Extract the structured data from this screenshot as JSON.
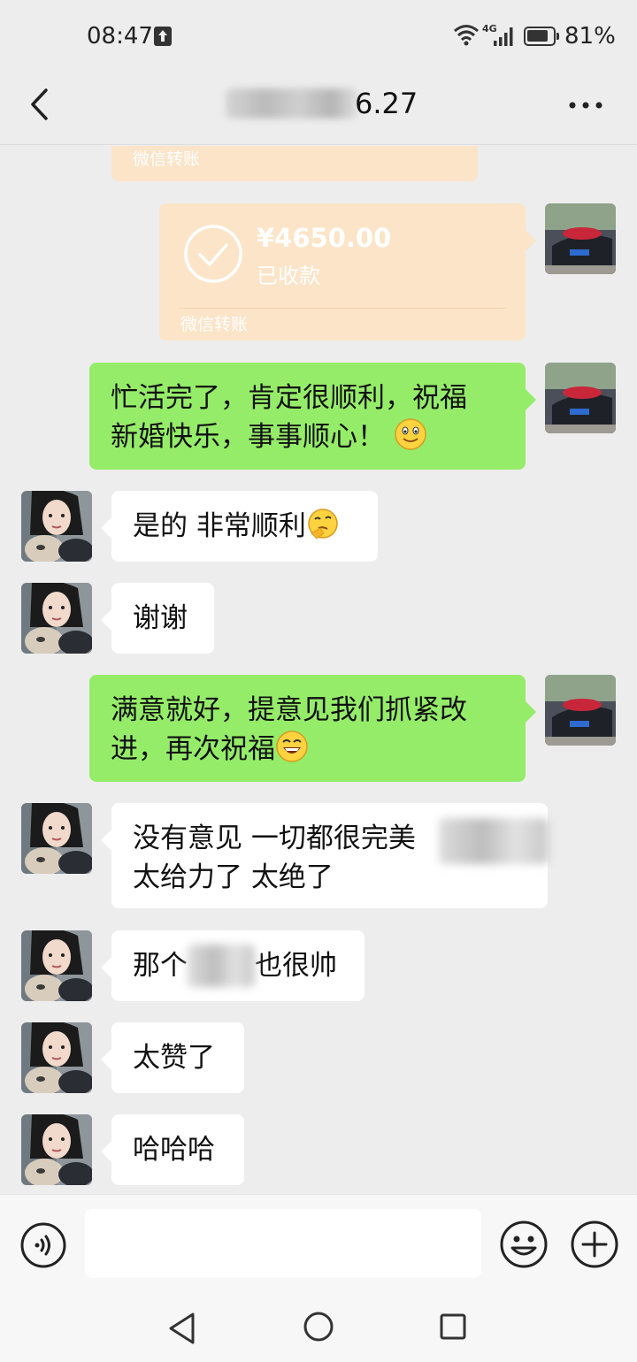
{
  "status_bar": {
    "time": "08:47",
    "network": "4G",
    "battery_percent": "81%"
  },
  "header": {
    "title_visible_suffix": "6.27"
  },
  "messages": [
    {
      "id": "transfer-0",
      "side": "left",
      "type": "transfer",
      "label": "微信转账"
    },
    {
      "id": "transfer-1",
      "side": "right",
      "type": "transfer",
      "amount": "¥4650.00",
      "status": "已收款",
      "label": "微信转账"
    },
    {
      "id": "m2",
      "side": "right",
      "type": "text",
      "lines": [
        "忙活完了，肯定很顺利，祝福",
        "新婚快乐，事事顺心！"
      ],
      "emoji": "smile"
    },
    {
      "id": "m3",
      "side": "left",
      "type": "text",
      "lines": [
        "是的 非常顺利"
      ],
      "emoji": "thinking"
    },
    {
      "id": "m4",
      "side": "left",
      "type": "text",
      "lines": [
        "谢谢"
      ]
    },
    {
      "id": "m5",
      "side": "right",
      "type": "text",
      "lines": [
        "满意就好，提意见我们抓紧改",
        "进，再次祝福"
      ],
      "emoji": "grin"
    },
    {
      "id": "m6",
      "side": "left",
      "type": "text",
      "lines": [
        "没有意见 一切都很完美 ",
        "太给力了 太绝了"
      ]
    },
    {
      "id": "m7",
      "side": "left",
      "type": "text",
      "parts": [
        "那个",
        "也很帅"
      ]
    },
    {
      "id": "m8",
      "side": "left",
      "type": "text",
      "lines": [
        "太赞了"
      ]
    },
    {
      "id": "m9",
      "side": "left",
      "type": "text",
      "lines": [
        "哈哈哈"
      ]
    }
  ],
  "input_bar": {
    "placeholder": ""
  },
  "colors": {
    "background": "#ededed",
    "sent_bubble": "#95ec69",
    "received_bubble": "#ffffff",
    "transfer_card": "#fce4c8"
  },
  "icons": [
    "back-icon",
    "more-icon",
    "voice-icon",
    "emoji-icon",
    "plus-icon",
    "nav-back-icon",
    "nav-home-icon",
    "nav-recent-icon"
  ]
}
